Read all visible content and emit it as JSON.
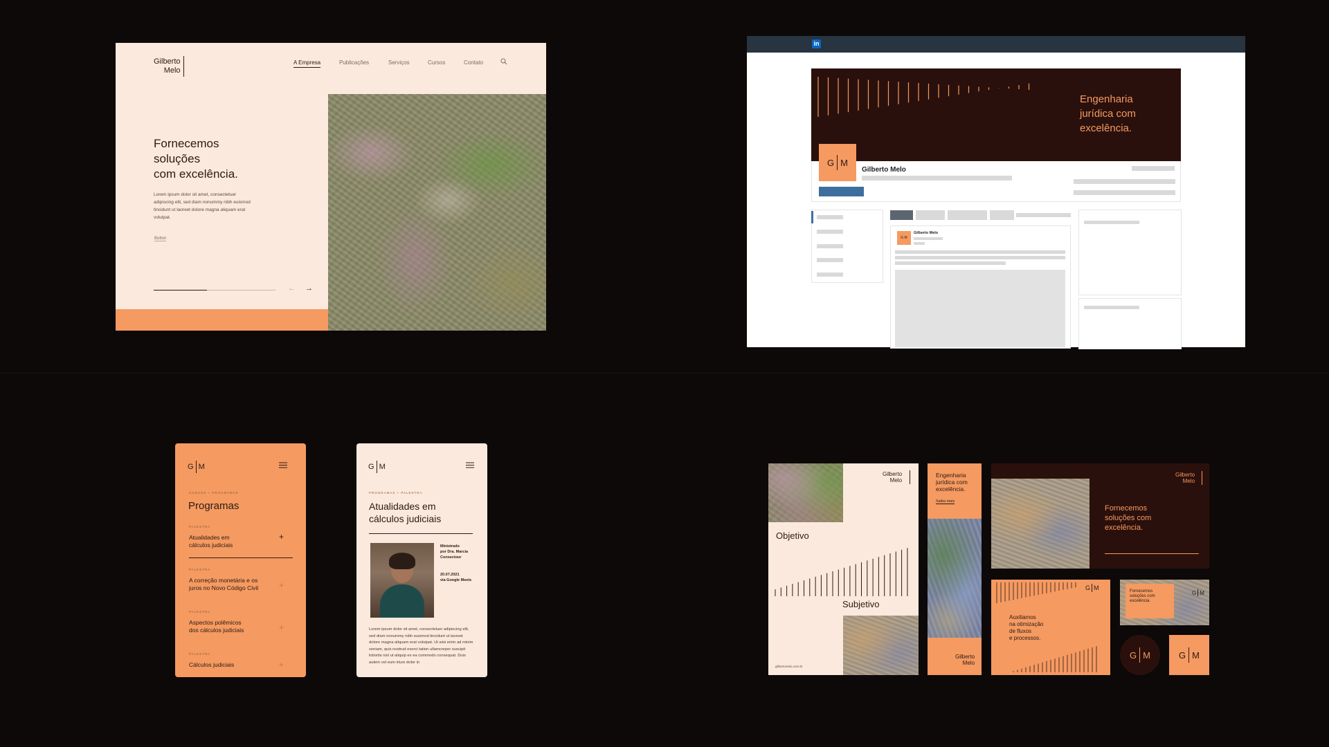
{
  "website": {
    "logo_line1": "Gilberto",
    "logo_line2": "Melo",
    "nav": [
      "A Empresa",
      "Publicações",
      "Serviços",
      "Cursos",
      "Contato"
    ],
    "hero_line1": "Fornecemos",
    "hero_line2": "soluções",
    "hero_line3": "com excelência.",
    "body": "Lorem ipsum dolor sit amet, consectetuer adipiscing elit, sed diam nonummy nibh euismod tincidunt ut laoreet dolore magna aliquam erat volutpat.",
    "button": "Button",
    "prev_arrow": "←",
    "next_arrow": "→",
    "slider_progress": 0.44,
    "accent": "#f59a61"
  },
  "linkedin": {
    "logo": "in",
    "cover_line1": "Engenharia",
    "cover_line2": "jurídica com",
    "cover_line3": "excelência.",
    "avatar_g": "G",
    "avatar_m": "M",
    "name": "Gilberto Melo",
    "post_author": "Gilberto Melo",
    "post_avatar": "G M",
    "button_color": "#3d6f9e"
  },
  "phone1": {
    "g": "G",
    "m": "M",
    "kicker": "CURSOS + PROGRAMAS",
    "title": "Programas",
    "items": [
      {
        "kicker": "PALESTRA",
        "title_l1": "Atualidades em",
        "title_l2": "cálculos judiciais"
      },
      {
        "kicker": "PALESTRA",
        "title_l1": "A correção monetária e os",
        "title_l2": "juros no Novo Código Civil"
      },
      {
        "kicker": "PALESTRA",
        "title_l1": "Aspectos polêmicos",
        "title_l2": "dos cálculos judiciais"
      },
      {
        "kicker": "PALESTRA",
        "title_l1": "Cálculos judiciais",
        "title_l2": ""
      }
    ]
  },
  "phone2": {
    "g": "G",
    "m": "M",
    "kicker": "PROGRAMAS + PALESTRA",
    "title_l1": "Atualidades em",
    "title_l2": "cálculos judiciais",
    "meta1_l1": "Ministrado",
    "meta1_l2": "por Dra. Marcia",
    "meta1_l3": "Consectour",
    "meta2_l1": "20.07.2021",
    "meta2_l2": "via Google Meets",
    "body": "Lorem ipsum dolor sit amet, consectetuer adipiscing elit, sed diam nonummy nibh euismod tincidunt ut laoreet dolore magna aliquam erat volutpat. Ut wisi enim ad minim veniam, quis nostrud exerci tation ullamcorper suscipit lobortis nisl ut aliquip ex ea commodo consequat. Duis autem vel eum iriure dolor in"
  },
  "stationery": {
    "poster_logo1": "Gilberto",
    "poster_logo2": "Melo",
    "objetivo": "Objetivo",
    "subjetivo": "Subjetivo",
    "poster_url": "gilbertomelo.com.br",
    "banner_l1": "Engenharia",
    "banner_l2": "jurídica com",
    "banner_l3": "excelência.",
    "banner_link": "Saiba mais",
    "banner_logo1": "Gilberto",
    "banner_logo2": "Melo",
    "card_logo1": "Gilberto",
    "card_logo2": "Melo",
    "card_l1": "Fornecemos",
    "card_l2": "soluções com",
    "card_l3": "excelência.",
    "orange_l1": "Auxiliamos",
    "orange_l2": "na otimização",
    "orange_l3": "de fluxos",
    "orange_l4": "e processos.",
    "mini_l1": "Fornecemos",
    "mini_l2": "soluções com",
    "mini_l3": "excelência.",
    "g": "G",
    "m": "M"
  }
}
